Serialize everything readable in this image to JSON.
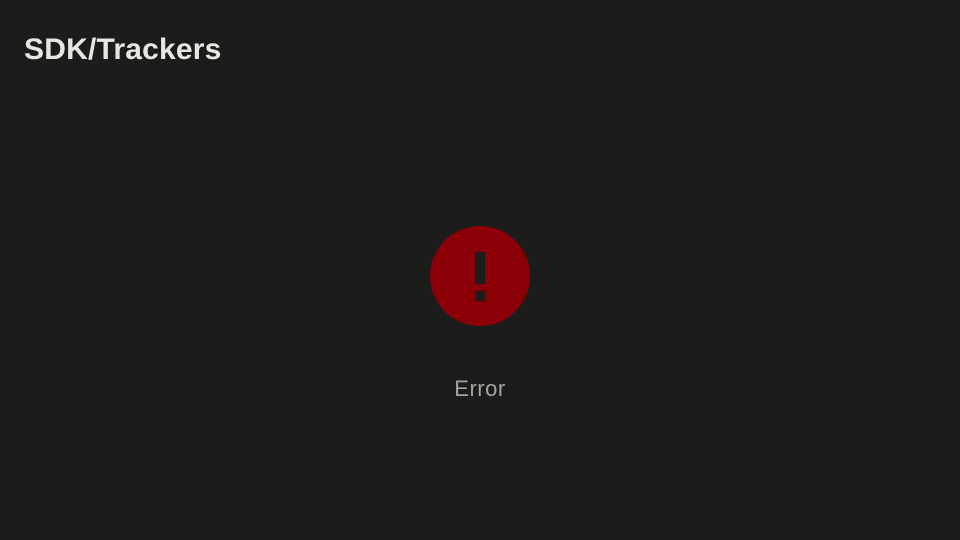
{
  "page": {
    "title": "SDK/Trackers"
  },
  "error_state": {
    "icon": "error-exclamation-icon",
    "label": "Error"
  },
  "colors": {
    "background": "#1c1d1b",
    "title_text": "#e6e6e3",
    "error_circle": "#8b0007",
    "error_glyph": "#1c1d1b",
    "error_label": "#a3a3a0"
  }
}
